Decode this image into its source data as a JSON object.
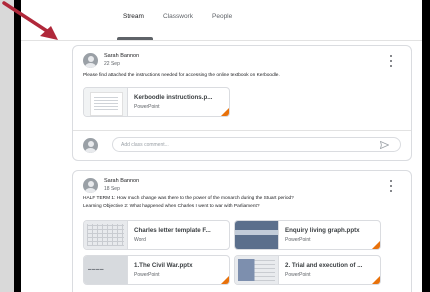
{
  "tabs": [
    {
      "label": "Stream"
    },
    {
      "label": "Classwork"
    },
    {
      "label": "People"
    }
  ],
  "posts": [
    {
      "author": "Sarah Bannon",
      "date": "22 Sep",
      "text_lines": [
        "Please find attached the instructions needed for accessing the online textbook on Kerboodle."
      ],
      "attachments": [
        {
          "title": "Kerboodle instructions.p...",
          "type": "PowerPoint"
        }
      ],
      "comment_placeholder": "Add class comment..."
    },
    {
      "author": "Sarah Bannon",
      "date": "18 Sep",
      "text_lines": [
        "HALF TERM 1: How much change was there to the power of the monarch during the Stuart period?",
        "Learning Objective 2: What happened when Charles I went to war with Parliament?"
      ],
      "attachments": [
        {
          "title": "Charles letter template F...",
          "type": "Word"
        },
        {
          "title": "Enquiry living graph.pptx",
          "type": "PowerPoint"
        },
        {
          "title": "1.The Civil War.pptx",
          "type": "PowerPoint"
        },
        {
          "title": "2. Trial and execution of ...",
          "type": "PowerPoint"
        }
      ]
    }
  ],
  "colors": {
    "accent_arrow": "#b0283a",
    "ppt_corner": "#e8710a"
  }
}
